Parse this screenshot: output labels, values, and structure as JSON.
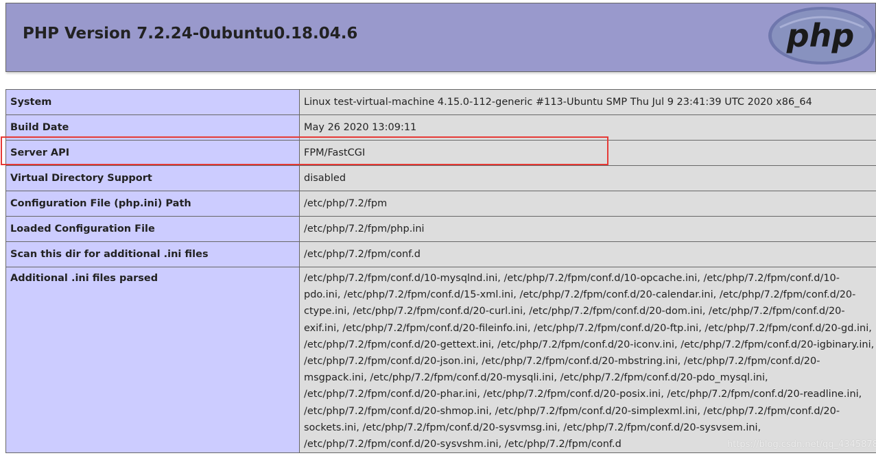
{
  "header": {
    "title": "PHP Version 7.2.24-0ubuntu0.18.04.6",
    "logo_text": "php"
  },
  "info_rows": [
    {
      "key": "System",
      "value": "Linux test-virtual-machine 4.15.0-112-generic #113-Ubuntu SMP Thu Jul 9 23:41:39 UTC 2020 x86_64"
    },
    {
      "key": "Build Date",
      "value": "May 26 2020 13:09:11"
    },
    {
      "key": "Server API",
      "value": "FPM/FastCGI"
    },
    {
      "key": "Virtual Directory Support",
      "value": "disabled"
    },
    {
      "key": "Configuration File (php.ini) Path",
      "value": "/etc/php/7.2/fpm"
    },
    {
      "key": "Loaded Configuration File",
      "value": "/etc/php/7.2/fpm/php.ini"
    },
    {
      "key": "Scan this dir for additional .ini files",
      "value": "/etc/php/7.2/fpm/conf.d"
    },
    {
      "key": "Additional .ini files parsed",
      "value": "/etc/php/7.2/fpm/conf.d/10-mysqlnd.ini, /etc/php/7.2/fpm/conf.d/10-opcache.ini, /etc/php/7.2/fpm/conf.d/10-pdo.ini, /etc/php/7.2/fpm/conf.d/15-xml.ini, /etc/php/7.2/fpm/conf.d/20-calendar.ini, /etc/php/7.2/fpm/conf.d/20-ctype.ini, /etc/php/7.2/fpm/conf.d/20-curl.ini, /etc/php/7.2/fpm/conf.d/20-dom.ini, /etc/php/7.2/fpm/conf.d/20-exif.ini, /etc/php/7.2/fpm/conf.d/20-fileinfo.ini, /etc/php/7.2/fpm/conf.d/20-ftp.ini, /etc/php/7.2/fpm/conf.d/20-gd.ini, /etc/php/7.2/fpm/conf.d/20-gettext.ini, /etc/php/7.2/fpm/conf.d/20-iconv.ini, /etc/php/7.2/fpm/conf.d/20-igbinary.ini, /etc/php/7.2/fpm/conf.d/20-json.ini, /etc/php/7.2/fpm/conf.d/20-mbstring.ini, /etc/php/7.2/fpm/conf.d/20-msgpack.ini, /etc/php/7.2/fpm/conf.d/20-mysqli.ini, /etc/php/7.2/fpm/conf.d/20-pdo_mysql.ini, /etc/php/7.2/fpm/conf.d/20-phar.ini, /etc/php/7.2/fpm/conf.d/20-posix.ini, /etc/php/7.2/fpm/conf.d/20-readline.ini, /etc/php/7.2/fpm/conf.d/20-shmop.ini, /etc/php/7.2/fpm/conf.d/20-simplexml.ini, /etc/php/7.2/fpm/conf.d/20-sockets.ini, /etc/php/7.2/fpm/conf.d/20-sysvmsg.ini, /etc/php/7.2/fpm/conf.d/20-sysvsem.ini, /etc/php/7.2/fpm/conf.d/20-sysvshm.ini, /etc/php/7.2/fpm/conf.d"
    }
  ],
  "watermark": "https://blog.csdn.net/qq_43458780",
  "colors": {
    "header_bg": "#9999cc",
    "key_cell_bg": "#ccccff",
    "value_cell_bg": "#dddddd",
    "highlight_border": "#e53935",
    "logo_bg": "#8892bf"
  }
}
